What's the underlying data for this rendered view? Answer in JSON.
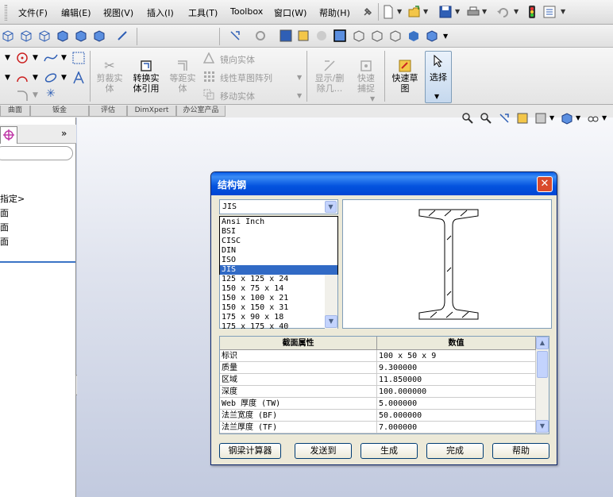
{
  "menu": {
    "items": [
      "文件(F)",
      "编辑(E)",
      "视图(V)",
      "插入(I)",
      "工具(T)",
      "Toolbox",
      "窗口(W)",
      "帮助(H)"
    ]
  },
  "ribbon": {
    "trim_entities": "剪裁实体",
    "convert_entities": "转换实体引用",
    "offset_entities": "等距实体",
    "mirror_entities": "镜向实体",
    "linear_pattern": "线性草图阵列",
    "move_entities": "移动实体",
    "show_hide": "显示/删除几...",
    "quick_snap": "快速捕捉",
    "rapid_sketch": "快速草图",
    "select": "选择"
  },
  "cm_tabs": [
    "曲面",
    "钣金",
    "评估",
    "DimXpert",
    "办公室产品"
  ],
  "left_panel": {
    "lines": [
      "指定>",
      "面",
      "面",
      "面"
    ]
  },
  "dialog": {
    "title": "结构钢",
    "standard_selected": "JIS",
    "standards": [
      "Ansi Inch",
      "BSI",
      "CISC",
      "DIN",
      "ISO",
      "JIS"
    ],
    "sizes": [
      "125 x 125 x 24",
      "150 x 75 x 14",
      "150 x 100 x 21",
      "150 x 150 x 31",
      "175 x 90 x 18",
      "175 x 175 x 40"
    ],
    "table_headers": [
      "截面属性",
      "数值"
    ],
    "properties": [
      {
        "name": "标识",
        "value": "100 x 50 x 9"
      },
      {
        "name": "质量",
        "value": "9.300000"
      },
      {
        "name": "区域",
        "value": "11.850000"
      },
      {
        "name": "深度",
        "value": "100.000000"
      },
      {
        "name": "Web 厚度 (TW)",
        "value": "5.000000"
      },
      {
        "name": "法兰宽度 (BF)",
        "value": "50.000000"
      },
      {
        "name": "法兰厚度  (TF)",
        "value": "7.000000"
      }
    ],
    "buttons": {
      "calculator": "钢梁计算器",
      "send_to": "发送到",
      "generate": "生成",
      "done": "完成",
      "help": "帮助"
    }
  }
}
